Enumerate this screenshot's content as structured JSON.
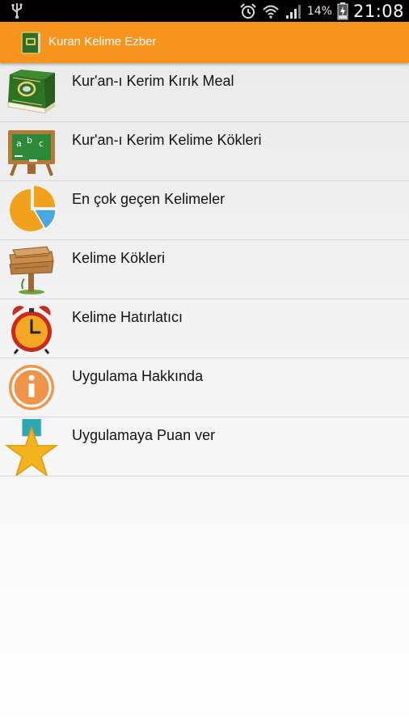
{
  "status_bar": {
    "battery_percent": "14%",
    "time": "21:08",
    "icons": [
      "usb-icon",
      "alarm-icon",
      "wifi-icon",
      "signal-icon",
      "battery-icon"
    ]
  },
  "action_bar": {
    "title": "Kuran Kelime Ezber",
    "icon": "quran-book-icon",
    "background_color": "#f7941d"
  },
  "menu": {
    "items": [
      {
        "label": "Kur'an-ı Kerim Kırık Meal",
        "icon": "quran-book-icon"
      },
      {
        "label": "Kur'an-ı Kerim Kelime Kökleri",
        "icon": "chalkboard-abc-icon"
      },
      {
        "label": "En çok geçen Kelimeler",
        "icon": "pie-chart-icon"
      },
      {
        "label": "Kelime Kökleri",
        "icon": "wooden-signpost-icon"
      },
      {
        "label": "Kelime Hatırlatıcı",
        "icon": "alarm-clock-icon"
      },
      {
        "label": "Uygulama Hakkında",
        "icon": "info-icon"
      },
      {
        "label": "Uygulamaya Puan ver",
        "icon": "star-medal-icon"
      }
    ]
  }
}
